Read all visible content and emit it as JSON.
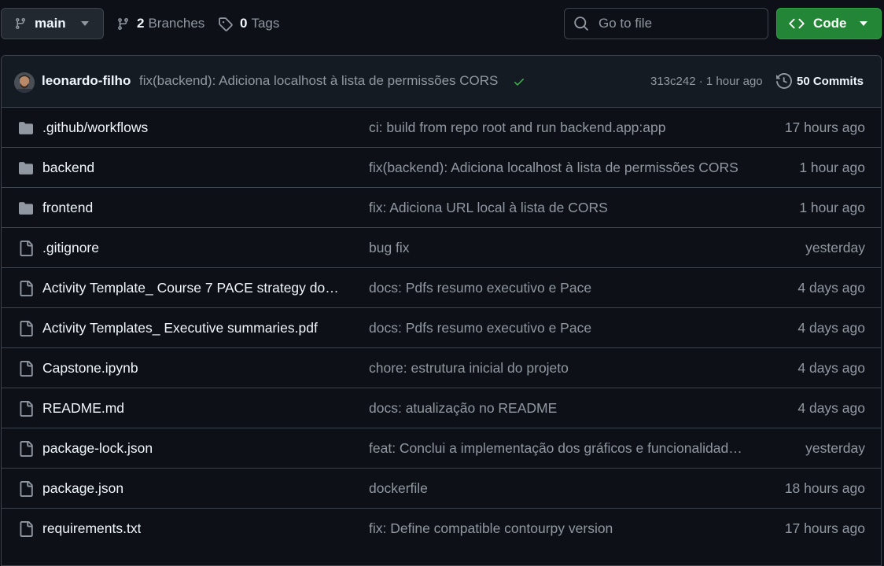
{
  "toolbar": {
    "branch": {
      "label": "main",
      "icon": "git-branch-icon"
    },
    "branches": {
      "count": "2",
      "label": "Branches"
    },
    "tags": {
      "count": "0",
      "label": "Tags"
    },
    "search": {
      "placeholder": "Go to file"
    },
    "code_button": {
      "label": "Code"
    }
  },
  "latest_commit": {
    "author": "leonardo-filho",
    "message": "fix(backend): Adiciona localhost à lista de permissões CORS",
    "status": "success",
    "sha": "313c242",
    "separator": " · ",
    "time": "1 hour ago",
    "commits_label": "50 Commits"
  },
  "files": [
    {
      "type": "folder",
      "name": ".github/workflows",
      "message": "ci: build from repo root and run backend.app:app",
      "time": "17 hours ago"
    },
    {
      "type": "folder",
      "name": "backend",
      "message": "fix(backend): Adiciona localhost à lista de permissões CORS",
      "time": "1 hour ago"
    },
    {
      "type": "folder",
      "name": "frontend",
      "message": "fix: Adiciona URL local à lista de CORS",
      "time": "1 hour ago"
    },
    {
      "type": "file",
      "name": ".gitignore",
      "message": "bug fix",
      "time": "yesterday"
    },
    {
      "type": "file",
      "name": "Activity Template_ Course 7 PACE strategy doc...",
      "message": "docs: Pdfs resumo executivo e Pace",
      "time": "4 days ago"
    },
    {
      "type": "file",
      "name": "Activity Templates_ Executive summaries.pdf",
      "message": "docs: Pdfs resumo executivo e Pace",
      "time": "4 days ago"
    },
    {
      "type": "file",
      "name": "Capstone.ipynb",
      "message": "chore: estrutura inicial do projeto",
      "time": "4 days ago"
    },
    {
      "type": "file",
      "name": "README.md",
      "message": "docs: atualização no README",
      "time": "4 days ago"
    },
    {
      "type": "file",
      "name": "package-lock.json",
      "message": "feat: Conclui a implementação dos gráficos e funcionalidade...",
      "time": "yesterday"
    },
    {
      "type": "file",
      "name": "package.json",
      "message": "dockerfile",
      "time": "18 hours ago"
    },
    {
      "type": "file",
      "name": "requirements.txt",
      "message": "fix: Define compatible contourpy version",
      "time": "17 hours ago"
    }
  ],
  "colors": {
    "background": "#0d1117",
    "accent_green": "#238636",
    "check_green": "#3fb950",
    "muted_text": "#9198a1",
    "folder_icon": "#9198a1"
  }
}
